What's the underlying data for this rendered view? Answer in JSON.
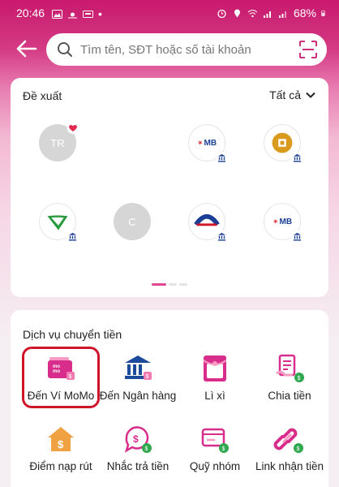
{
  "status_bar": {
    "time": "20:46",
    "battery": "68%"
  },
  "search": {
    "placeholder": "Tìm tên, SĐT hoặc số tài khoản"
  },
  "suggestions": {
    "title": "Đề xuất",
    "see_all": "Tất cả",
    "contacts": [
      {
        "type": "avatar",
        "initials": "TR",
        "favorite": true
      },
      {
        "type": "bank",
        "bank_text": "MB"
      },
      {
        "type": "bank",
        "bank": "gold-coin-bank"
      },
      {
        "type": "bank",
        "bank": "green-swoosh-bank"
      },
      {
        "type": "avatar",
        "initials": "C"
      },
      {
        "type": "bank",
        "bank": "blue-arc-bank"
      },
      {
        "type": "bank",
        "bank_text": "MB"
      }
    ],
    "page_count": 3,
    "active_page": 1
  },
  "services": {
    "title": "Dịch vụ chuyển tiền",
    "items": [
      {
        "label": "Đến Ví MoMo",
        "icon": "momo-wallet-icon",
        "highlighted": true
      },
      {
        "label": "Đến Ngân hàng",
        "icon": "bank-icon"
      },
      {
        "label": "Lì xì",
        "icon": "red-envelope-icon"
      },
      {
        "label": "Chia tiền",
        "icon": "split-bill-icon"
      },
      {
        "label": "Điểm nạp rút",
        "icon": "house-money-icon"
      },
      {
        "label": "Nhắc trả tiền",
        "icon": "payment-reminder-icon"
      },
      {
        "label": "Quỹ nhóm",
        "icon": "group-fund-icon"
      },
      {
        "label": "Link nhận tiền",
        "icon": "link-icon"
      }
    ]
  },
  "colors": {
    "brand": "#c8196e",
    "accent_pink": "#e0478f",
    "highlight_red": "#d0142a",
    "mb_blue": "#1b3f95"
  }
}
